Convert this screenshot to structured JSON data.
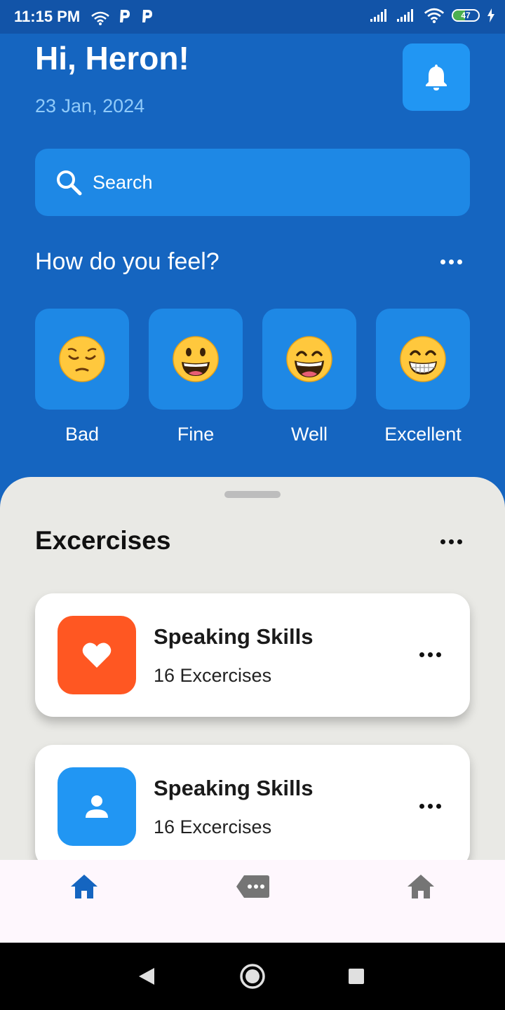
{
  "status_bar": {
    "time": "11:15 PM",
    "battery": "47",
    "battery_fraction": 0.47
  },
  "header": {
    "greeting": "Hi, Heron!",
    "date": "23 Jan, 2024"
  },
  "search": {
    "placeholder": "Search"
  },
  "feel": {
    "title": "How do you feel?",
    "moods": [
      {
        "label": "Bad",
        "emoji": "pensive-face"
      },
      {
        "label": "Fine",
        "emoji": "grinning-face"
      },
      {
        "label": "Well",
        "emoji": "grinning-face-with-big-eyes"
      },
      {
        "label": "Excellent",
        "emoji": "beaming-face"
      }
    ]
  },
  "exercises": {
    "title": "Excercises",
    "cards": [
      {
        "title": "Speaking Skills",
        "subtitle": "16 Excercises",
        "icon": "heart-icon",
        "color": "#FF5722"
      },
      {
        "title": "Speaking Skills",
        "subtitle": "16 Excercises",
        "icon": "person-icon",
        "color": "#2196F3"
      }
    ]
  },
  "bottom_nav": {
    "items": [
      "home-icon",
      "message-icon",
      "home-icon"
    ],
    "active_color": "#1565C0",
    "inactive_color": "#757575"
  },
  "colors": {
    "primary": "#1565C0",
    "tile": "#1E88E5",
    "sheet": "#E9E9E5"
  }
}
